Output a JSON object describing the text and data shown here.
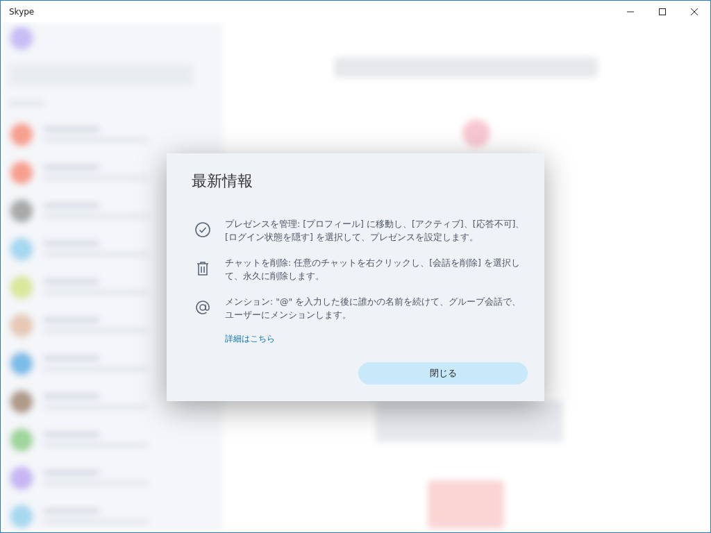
{
  "window": {
    "title": "Skype"
  },
  "dialog": {
    "title": "最新情報",
    "items": [
      {
        "kind": "check",
        "text": "プレゼンスを管理: [プロフィール] に移動し、[アクティブ]、[応答不可]、[ログイン状態を隠す] を選択して、プレゼンスを設定します。"
      },
      {
        "kind": "trash",
        "text": "チャットを削除: 任意のチャットを右クリックし、[会話を削除] を選択して、永久に削除します。"
      },
      {
        "kind": "at",
        "text": "メンション: \"@\" を入力した後に誰かの名前を続けて、グループ会話で、ユーザーにメンションします。"
      }
    ],
    "link": "詳細はこちら",
    "button": "閉じる"
  }
}
